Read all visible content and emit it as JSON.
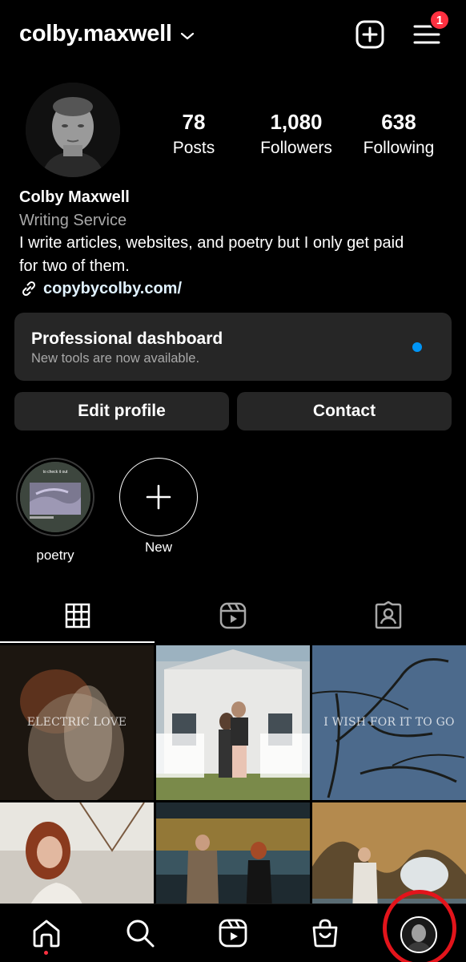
{
  "header": {
    "username": "colby.maxwell",
    "notification_count": "1"
  },
  "profile": {
    "stats": [
      {
        "value": "78",
        "label": "Posts"
      },
      {
        "value": "1,080",
        "label": "Followers"
      },
      {
        "value": "638",
        "label": "Following"
      }
    ],
    "name": "Colby Maxwell",
    "category": "Writing Service",
    "bio_line1": "I write articles, websites, and poetry but I only get paid",
    "bio_line2": "for two of them.",
    "link": "copybycolby.com/"
  },
  "dashboard": {
    "title": "Professional dashboard",
    "subtitle": "New tools are now available."
  },
  "buttons": {
    "edit_profile": "Edit profile",
    "contact": "Contact"
  },
  "highlights": [
    {
      "label": "poetry",
      "thumb_caption": "to check it out"
    },
    {
      "label": "New"
    }
  ],
  "tabs": [
    "grid-icon",
    "reels-icon",
    "tagged-icon"
  ],
  "grid_posts": [
    {
      "overlay_text": "ELECTRIC LOVE"
    },
    {
      "overlay_text": ""
    },
    {
      "overlay_text": "I WISH FOR IT TO GO"
    },
    {
      "overlay_text": ""
    },
    {
      "overlay_text": ""
    },
    {
      "overlay_text": ""
    }
  ],
  "nav": [
    "home-icon",
    "search-icon",
    "reels-icon",
    "shop-icon",
    "profile-avatar"
  ],
  "colors": {
    "background": "#000000",
    "card": "#262626",
    "accent_blue": "#0095f6",
    "badge_red": "#ff3040",
    "secondary_text": "#a8a8a8"
  }
}
